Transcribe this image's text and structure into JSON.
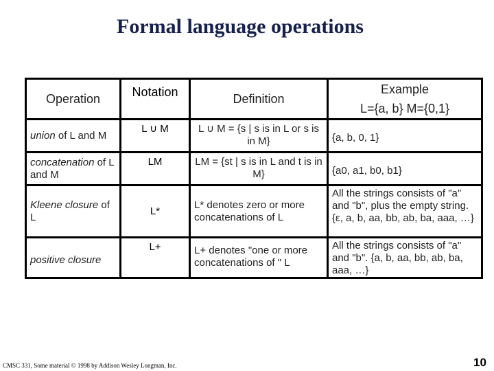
{
  "slide": {
    "title": "Formal language operations",
    "footer": "CMSC 331, Some material © 1998 by Addison Wesley Longman, Inc.",
    "page_number": "10"
  },
  "table": {
    "headers": {
      "operation": "Operation",
      "notation": "Notation",
      "definition": "Definition",
      "example_line1": "Example",
      "example_line2": "L={a, b}  M={0,1}"
    },
    "rows": [
      {
        "operation_italic": "union",
        "operation_rest": " of L and M",
        "notation": "L ∪ M",
        "definition": "L ∪ M = {s | s is in L or s is in M}",
        "example": "{a, b, 0, 1}"
      },
      {
        "operation_italic": "concatenation",
        "operation_rest": " of L and M",
        "notation": "LM",
        "definition": "LM = {st | s is in L and t is in M}",
        "example": "{a0, a1, b0, b1}"
      },
      {
        "operation_italic": "Kleene closure",
        "operation_rest": " of L",
        "notation": "L*",
        "definition": "L* denotes zero or more concatenations of  L",
        "example": "All the strings consists of \"a\" and \"b\", plus the empty string. {ε, a, b, aa, bb, ab, ba,  aaa, …}"
      },
      {
        "operation_italic": "positive closure",
        "operation_rest": "",
        "notation": "L+",
        "definition": "L+ denotes \"one or more concatenations of \" L",
        "example": "All the strings consists of \"a\" and \"b\". {a, b, aa, bb, ab, ba, aaa, …}"
      }
    ]
  }
}
